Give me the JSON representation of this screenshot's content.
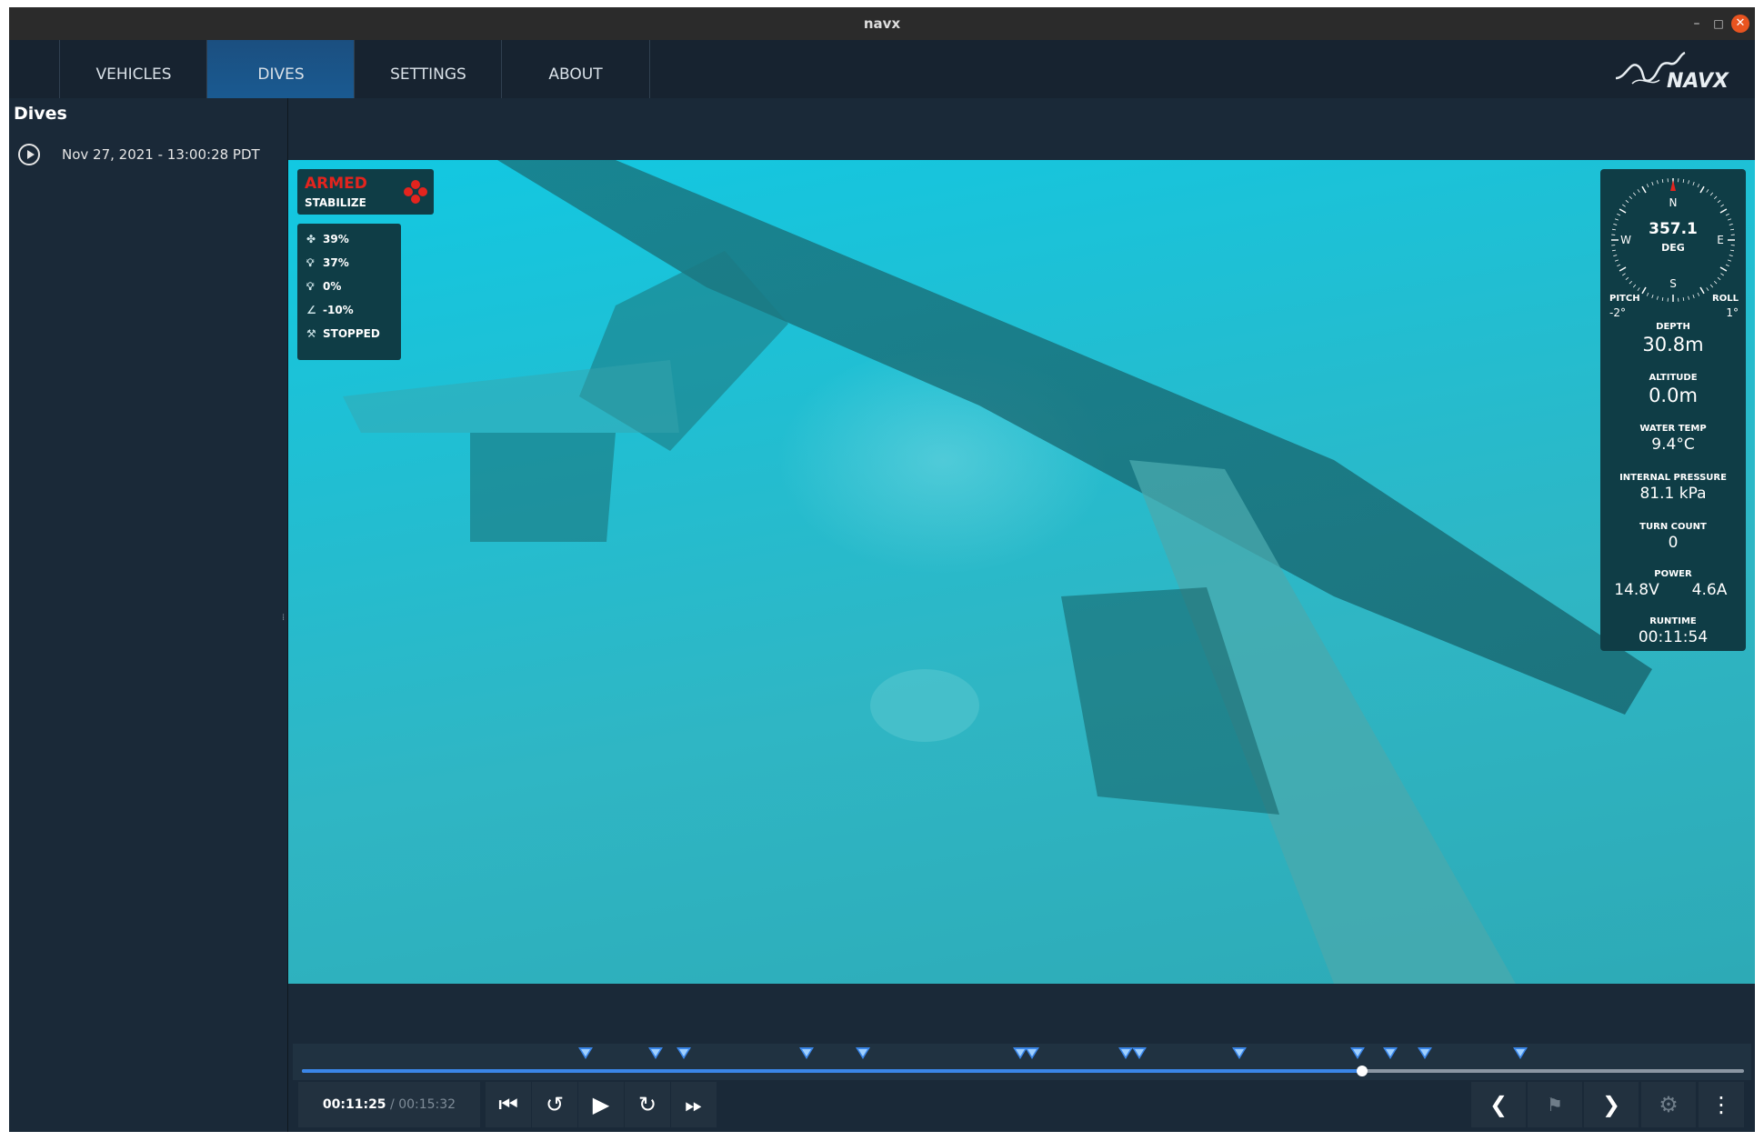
{
  "window": {
    "title": "navx",
    "minimize_label": "–",
    "maximize_label": "□",
    "close_label": "✕"
  },
  "nav": {
    "tabs": [
      {
        "label": "VEHICLES"
      },
      {
        "label": "DIVES"
      },
      {
        "label": "SETTINGS"
      },
      {
        "label": "ABOUT"
      }
    ],
    "active_tab": "DIVES",
    "logo_text": "NAVX"
  },
  "sidebar": {
    "title": "Dives",
    "dives": [
      {
        "label": "Nov 27, 2021 - 13:00:28 PDT",
        "icon": "play-circle-icon"
      }
    ]
  },
  "overlay": {
    "armed": "ARMED",
    "mode": "STABILIZE",
    "telemetry": [
      {
        "icon": "fan-icon",
        "value": "39%"
      },
      {
        "icon": "light-icon",
        "value": "37%"
      },
      {
        "icon": "light-icon",
        "value": "0%"
      },
      {
        "icon": "tilt-icon",
        "value": "-10%"
      },
      {
        "icon": "claw-icon",
        "value": "STOPPED"
      }
    ],
    "compass": {
      "heading": "357.1",
      "unit": "DEG",
      "north": "N",
      "south": "S",
      "east": "E",
      "west": "W"
    },
    "pitch": {
      "label": "PITCH",
      "value": "-2°"
    },
    "roll": {
      "label": "ROLL",
      "value": "1°"
    },
    "depth": {
      "label": "DEPTH",
      "value": "30.8m"
    },
    "altitude": {
      "label": "ALTITUDE",
      "value": "0.0m"
    },
    "water_temp": {
      "label": "WATER TEMP",
      "value": "9.4°C"
    },
    "internal_pressure": {
      "label": "INTERNAL PRESSURE",
      "value": "81.1 kPa"
    },
    "turn_count": {
      "label": "TURN COUNT",
      "value": "0"
    },
    "power": {
      "label": "POWER",
      "voltage": "14.8V",
      "current": "4.6A"
    },
    "runtime": {
      "label": "RUNTIME",
      "value": "00:11:54"
    }
  },
  "playback": {
    "current_time": "00:11:25",
    "separator": "/",
    "total_time": "00:15:32",
    "progress_fraction": 0.735,
    "marker_positions": [
      0.197,
      0.245,
      0.265,
      0.35,
      0.389,
      0.498,
      0.506,
      0.571,
      0.581,
      0.65,
      0.732,
      0.755,
      0.779,
      0.845
    ]
  },
  "colors": {
    "accent": "#3a86e8",
    "armed": "#e3241e",
    "panel": "#0f3d46",
    "background": "#1a2938"
  }
}
